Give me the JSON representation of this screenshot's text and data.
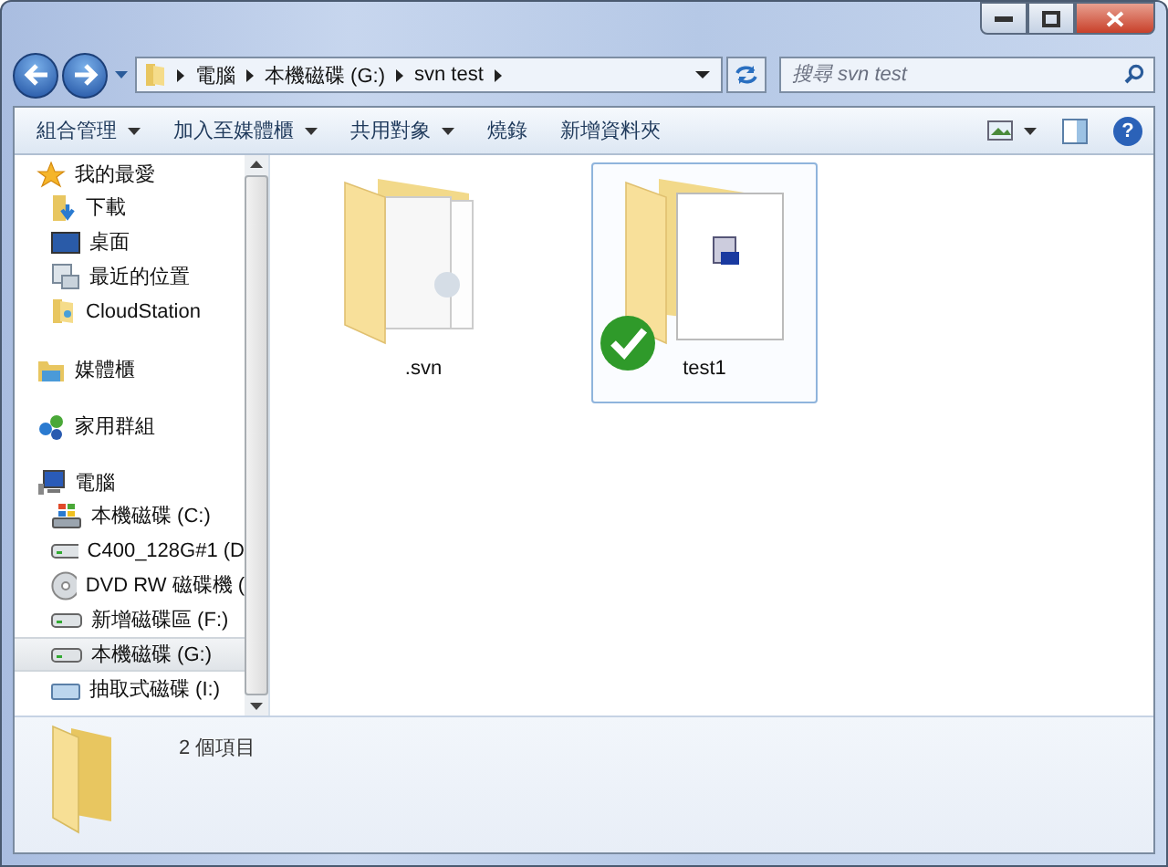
{
  "address_bar": {
    "segments": [
      "電腦",
      "本機磁碟 (G:)",
      "svn test"
    ]
  },
  "search": {
    "placeholder": "搜尋 svn test"
  },
  "toolbar": {
    "items": [
      {
        "label": "組合管理",
        "dropdown": true
      },
      {
        "label": "加入至媒體櫃",
        "dropdown": true
      },
      {
        "label": "共用對象",
        "dropdown": true
      },
      {
        "label": "燒錄",
        "dropdown": false
      },
      {
        "label": "新增資料夾",
        "dropdown": false
      }
    ],
    "help_label": "?"
  },
  "sidebar": {
    "groups": [
      {
        "label": "我的最愛",
        "kind": "favorites",
        "children": [
          {
            "label": "下載",
            "kind": "download",
            "selected": false
          },
          {
            "label": "桌面",
            "kind": "desktop",
            "selected": false
          },
          {
            "label": "最近的位置",
            "kind": "recent",
            "selected": false
          },
          {
            "label": "CloudStation",
            "kind": "folder",
            "selected": false
          }
        ]
      },
      {
        "label": "媒體櫃",
        "kind": "library"
      },
      {
        "label": "家用群組",
        "kind": "homegroup"
      },
      {
        "label": "電腦",
        "kind": "computer",
        "children": [
          {
            "label": "本機磁碟 (C:)",
            "kind": "sysdrive",
            "selected": false
          },
          {
            "label": "C400_128G#1 (D",
            "kind": "drive",
            "selected": false
          },
          {
            "label": "DVD RW 磁碟機 (",
            "kind": "dvd",
            "selected": false
          },
          {
            "label": "新增磁碟區 (F:)",
            "kind": "drive",
            "selected": false
          },
          {
            "label": "本機磁碟 (G:)",
            "kind": "drive",
            "selected": true
          },
          {
            "label": "抽取式磁碟 (I:)",
            "kind": "removable",
            "selected": false
          }
        ]
      }
    ]
  },
  "files": [
    {
      "name": ".svn",
      "kind": "docs",
      "selected": false,
      "synced": false
    },
    {
      "name": "test1",
      "kind": "app",
      "selected": true,
      "synced": true
    }
  ],
  "details": {
    "count": "2 個項目"
  }
}
